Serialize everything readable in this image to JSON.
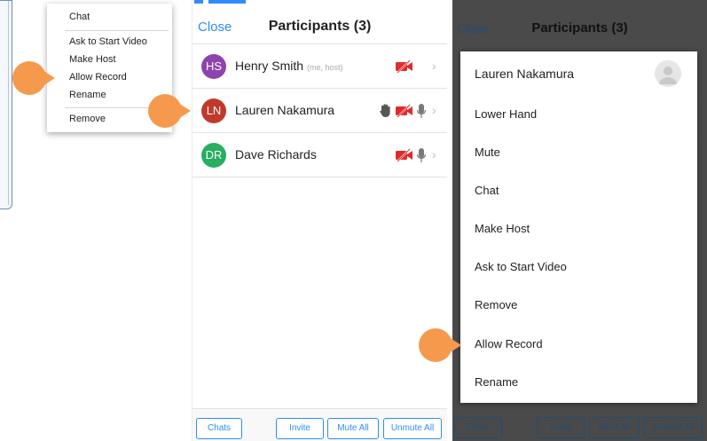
{
  "context_menu": {
    "items": [
      "Chat",
      "Ask to Start Video",
      "Make Host",
      "Allow Record",
      "Rename",
      "Remove"
    ]
  },
  "participants_ios": {
    "close_label": "Close",
    "title": "Participants (3)",
    "rows": [
      {
        "initials": "HS",
        "name": "Henry Smith",
        "note": "(me, host)",
        "color": "#8e44ad"
      },
      {
        "initials": "LN",
        "name": "Lauren Nakamura",
        "note": "",
        "color": "#c0392b"
      },
      {
        "initials": "DR",
        "name": "Dave Richards",
        "note": "",
        "color": "#27ae60"
      }
    ],
    "toolbar": {
      "chats": "Chats",
      "invite": "Invite",
      "mute_all": "Mute All",
      "unmute_all": "Unmute All"
    }
  },
  "participants_android": {
    "close_label": "Close",
    "title": "Participants (3)",
    "sheet": {
      "name": "Lauren Nakamura",
      "items": [
        "Lower Hand",
        "Mute",
        "Chat",
        "Make Host",
        "Ask to Start Video",
        "Remove",
        "Allow Record",
        "Rename"
      ]
    },
    "toolbar": {
      "chats": "Chats",
      "invite": "Invite",
      "mute_all": "Mute All",
      "unmute_all": "Unmute All"
    }
  },
  "colors": {
    "accent": "#2d8cff",
    "pointer": "#f59a4d",
    "video_off": "#e02b2b"
  }
}
